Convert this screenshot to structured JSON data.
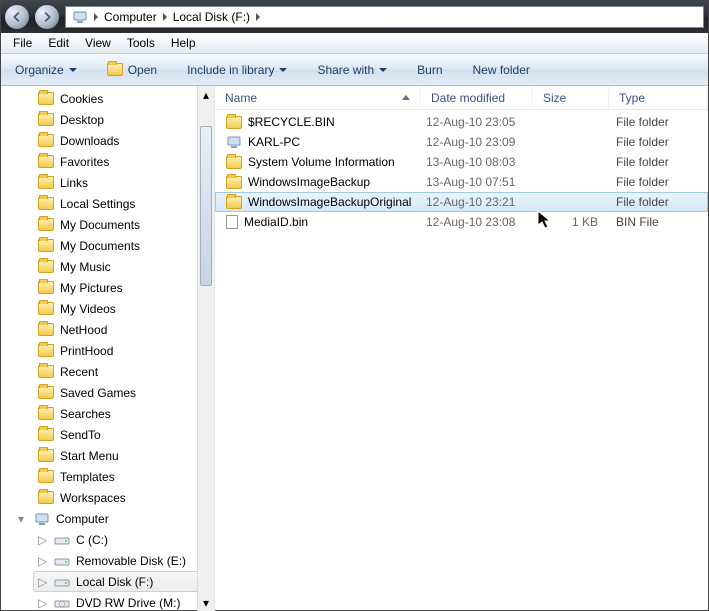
{
  "breadcrumbs": {
    "root_icon": "computer",
    "seg1": "Computer",
    "seg2": "Local Disk (F:)"
  },
  "menubar": {
    "file": "File",
    "edit": "Edit",
    "view": "View",
    "tools": "Tools",
    "help": "Help"
  },
  "cmdbar": {
    "organize": "Organize",
    "open": "Open",
    "include": "Include in library",
    "share": "Share with",
    "burn": "Burn",
    "newfolder": "New folder"
  },
  "treehead": {
    "computer": "Computer"
  },
  "tree": [
    {
      "label": "Cookies",
      "icon": "folder"
    },
    {
      "label": "Desktop",
      "icon": "folder"
    },
    {
      "label": "Downloads",
      "icon": "folder"
    },
    {
      "label": "Favorites",
      "icon": "folder"
    },
    {
      "label": "Links",
      "icon": "folder"
    },
    {
      "label": "Local Settings",
      "icon": "folder"
    },
    {
      "label": "My Documents",
      "icon": "folder"
    },
    {
      "label": "My Documents",
      "icon": "folder"
    },
    {
      "label": "My Music",
      "icon": "folder"
    },
    {
      "label": "My Pictures",
      "icon": "folder"
    },
    {
      "label": "My Videos",
      "icon": "folder"
    },
    {
      "label": "NetHood",
      "icon": "folder"
    },
    {
      "label": "PrintHood",
      "icon": "folder"
    },
    {
      "label": "Recent",
      "icon": "folder"
    },
    {
      "label": "Saved Games",
      "icon": "folder"
    },
    {
      "label": "Searches",
      "icon": "folder"
    },
    {
      "label": "SendTo",
      "icon": "folder"
    },
    {
      "label": "Start Menu",
      "icon": "folder"
    },
    {
      "label": "Templates",
      "icon": "folder"
    },
    {
      "label": "Workspaces",
      "icon": "folder"
    }
  ],
  "drives": [
    {
      "label": "C (C:)",
      "icon": "drive"
    },
    {
      "label": "Removable Disk (E:)",
      "icon": "drive"
    },
    {
      "label": "Local Disk (F:)",
      "icon": "drive",
      "selected": true
    },
    {
      "label": "DVD RW Drive (M:)",
      "icon": "cd"
    }
  ],
  "columns": {
    "name": "Name",
    "date": "Date modified",
    "size": "Size",
    "type": "Type"
  },
  "files": [
    {
      "name": "$RECYCLE.BIN",
      "date": "12-Aug-10 23:05",
      "size": "",
      "type": "File folder",
      "icon": "folder"
    },
    {
      "name": "KARL-PC",
      "date": "12-Aug-10 23:09",
      "size": "",
      "type": "File folder",
      "icon": "computer"
    },
    {
      "name": "System Volume Information",
      "date": "13-Aug-10 08:03",
      "size": "",
      "type": "File folder",
      "icon": "folder"
    },
    {
      "name": "WindowsImageBackup",
      "date": "13-Aug-10 07:51",
      "size": "",
      "type": "File folder",
      "icon": "folder"
    },
    {
      "name": "WindowsImageBackupOriginal",
      "date": "12-Aug-10 23:21",
      "size": "",
      "type": "File folder",
      "icon": "folder",
      "selected": true
    },
    {
      "name": "MediaID.bin",
      "date": "12-Aug-10 23:08",
      "size": "1 KB",
      "type": "BIN File",
      "icon": "file"
    }
  ]
}
